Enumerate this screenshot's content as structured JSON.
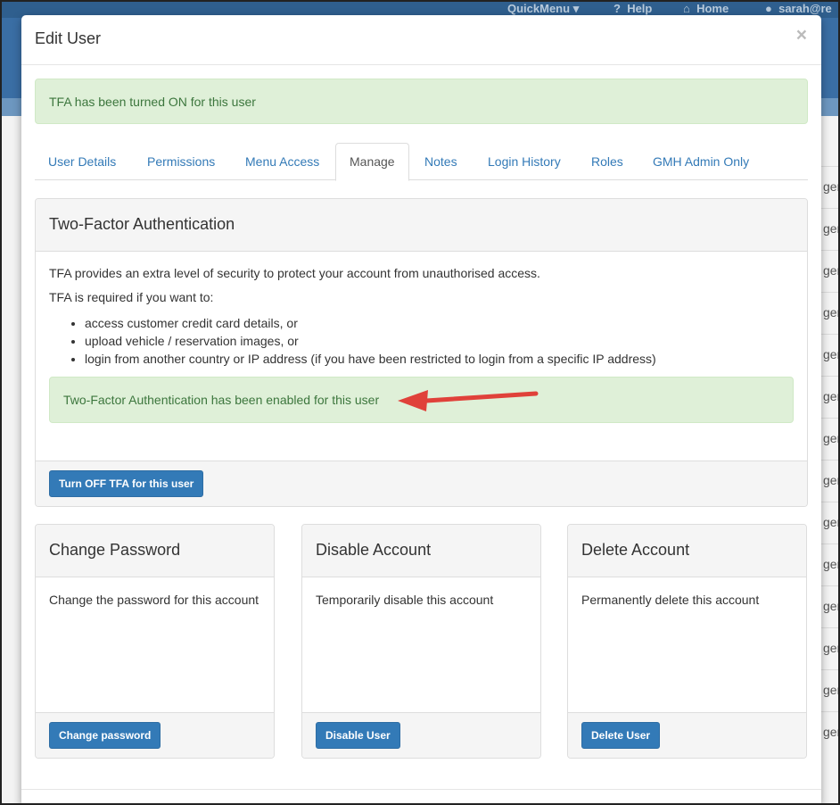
{
  "background": {
    "topnav": {
      "quickmenu": "QuickMenu",
      "help": "Help",
      "home": "Home",
      "user": "sarah@re"
    },
    "row_fragments": [
      "gen",
      "gen",
      "gen",
      "gen",
      "gen",
      "gen",
      "gen",
      "gen",
      "gen",
      "gen",
      "gen",
      "gen",
      "gen",
      "gen"
    ]
  },
  "modal": {
    "title": "Edit User",
    "close": "×",
    "status_alert": "TFA has been turned ON for this user"
  },
  "tabs": [
    {
      "label": "User Details"
    },
    {
      "label": "Permissions"
    },
    {
      "label": "Menu Access"
    },
    {
      "label": "Manage",
      "active": true
    },
    {
      "label": "Notes"
    },
    {
      "label": "Login History"
    },
    {
      "label": "Roles"
    },
    {
      "label": "GMH Admin Only"
    }
  ],
  "tfa_panel": {
    "heading": "Two-Factor Authentication",
    "intro": "TFA provides an extra level of security to protect your account from unauthorised access.",
    "required_label": "TFA is required if you want to:",
    "requirements": [
      "access customer credit card details, or",
      "upload vehicle / reservation images, or",
      "login from another country or IP address (if you have been restricted to login from a specific IP address)"
    ],
    "enabled_alert": "Two-Factor Authentication has been enabled for this user",
    "button": "Turn OFF TFA for this user"
  },
  "cards": [
    {
      "heading": "Change Password",
      "text": "Change the password for this account",
      "button": "Change password"
    },
    {
      "heading": "Disable Account",
      "text": "Temporarily disable this account",
      "button": "Disable User"
    },
    {
      "heading": "Delete Account",
      "text": "Permanently delete this account",
      "button": "Delete User"
    }
  ],
  "colors": {
    "primary": "#337ab7",
    "success_bg": "#dff0d8",
    "success_text": "#3c763d",
    "arrow": "#e0413a"
  }
}
